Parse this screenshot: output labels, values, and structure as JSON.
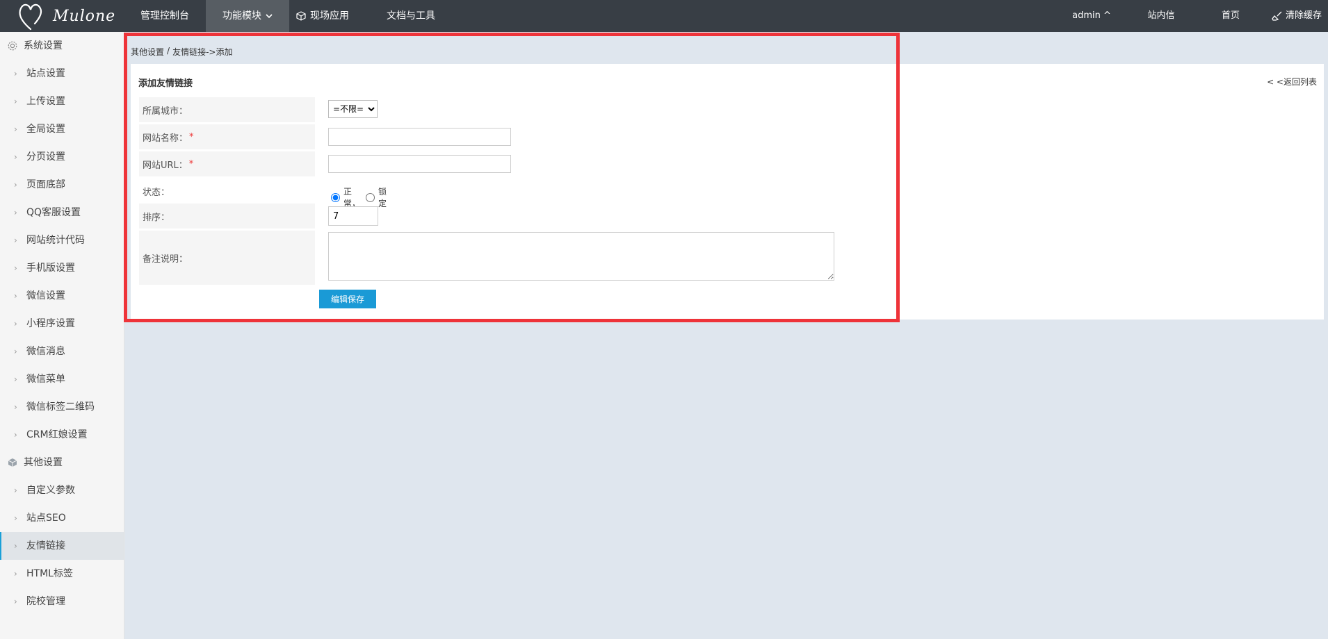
{
  "topbar": {
    "logo_text": "Mulone",
    "nav": [
      {
        "label": "管理控制台"
      },
      {
        "label": "功能模块"
      },
      {
        "label": "现场应用"
      },
      {
        "label": "文档与工具"
      }
    ],
    "user": "admin ^",
    "messages": "站内信",
    "home": "首页",
    "clear_cache": "清除缓存"
  },
  "sidebar": {
    "group1": "系统设置",
    "items1": [
      "站点设置",
      "上传设置",
      "全局设置",
      "分页设置",
      "页面底部",
      "QQ客服设置",
      "网站统计代码",
      "手机版设置",
      "微信设置",
      "小程序设置",
      "微信消息",
      "微信菜单",
      "微信标签二维码",
      "CRM红娘设置"
    ],
    "group2": "其他设置",
    "items2": [
      "自定义参数",
      "站点SEO",
      "友情链接",
      "HTML标签",
      "院校管理"
    ]
  },
  "breadcrumb": {
    "part1": "其他设置",
    "sep": "/",
    "part2": "友情链接->添加"
  },
  "panel": {
    "title": "添加友情链接",
    "back": "< <返回列表"
  },
  "form": {
    "city_label": "所属城市：",
    "city_value": "=不限=",
    "name_label": "网站名称：",
    "url_label": "网站URL：",
    "required_mark": "*",
    "status_label": "状态：",
    "status_normal": "正常，",
    "status_locked": "锁定",
    "sort_label": "排序：",
    "sort_value": "7",
    "note_label": "备注说明：",
    "save": "编辑保存"
  }
}
